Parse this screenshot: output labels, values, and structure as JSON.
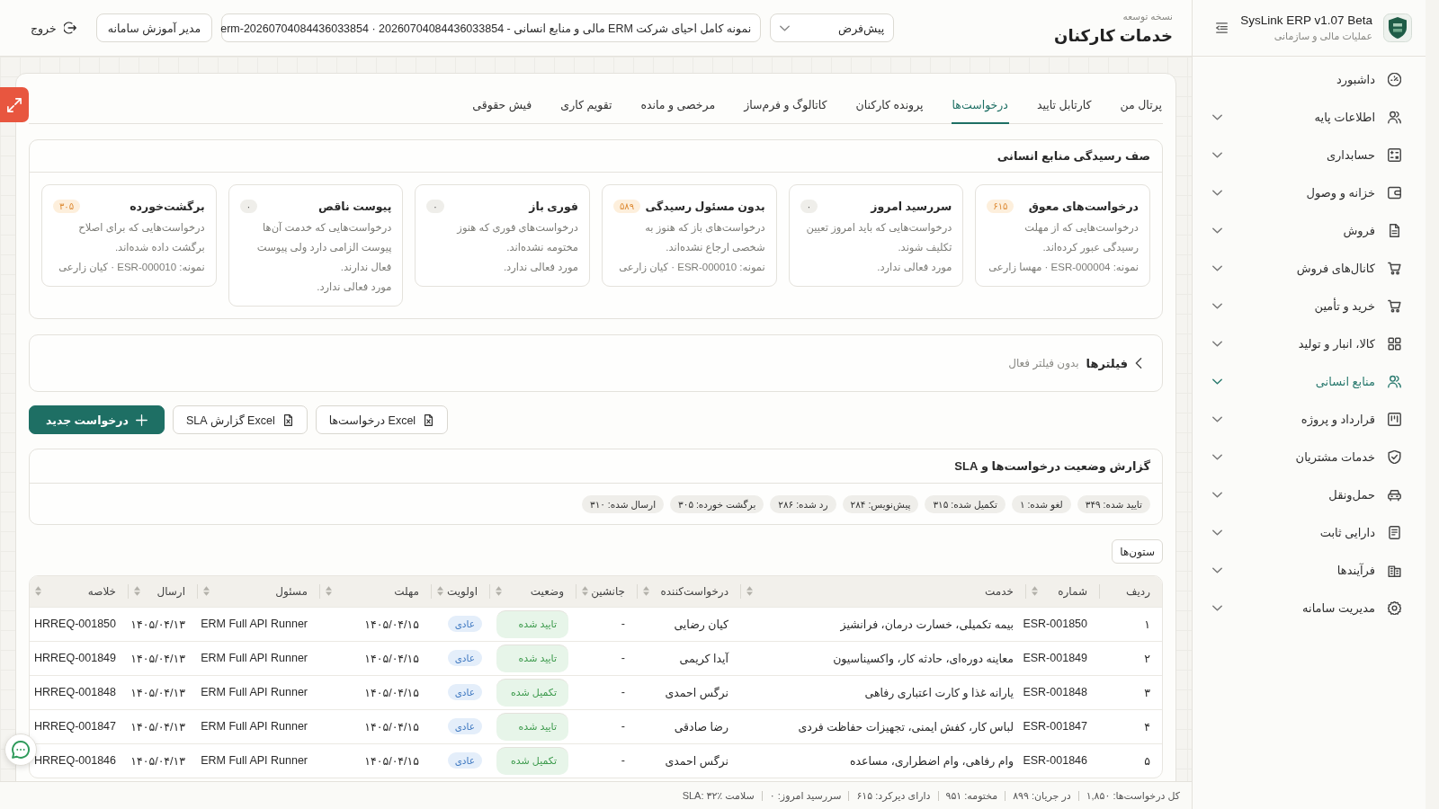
{
  "sidebar": {
    "brand": {
      "title": "SysLink ERP v1.07 Beta",
      "subtitle": "عملیات مالی و سازمانی"
    },
    "items": [
      {
        "label": "داشبورد",
        "expandable": false,
        "selected": false
      },
      {
        "label": "اطلاعات پایه",
        "expandable": true,
        "selected": false
      },
      {
        "label": "حسابداری",
        "expandable": true,
        "selected": false
      },
      {
        "label": "خزانه و وصول",
        "expandable": true,
        "selected": false
      },
      {
        "label": "فروش",
        "expandable": true,
        "selected": false
      },
      {
        "label": "کانال‌های فروش",
        "expandable": true,
        "selected": false
      },
      {
        "label": "خرید و تأمین",
        "expandable": true,
        "selected": false
      },
      {
        "label": "کالا، انبار و تولید",
        "expandable": true,
        "selected": false
      },
      {
        "label": "منابع انسانی",
        "expandable": true,
        "selected": true
      },
      {
        "label": "قرارداد و پروژه",
        "expandable": true,
        "selected": false
      },
      {
        "label": "خدمات مشتریان",
        "expandable": true,
        "selected": false
      },
      {
        "label": "حمل‌ونقل",
        "expandable": true,
        "selected": false
      },
      {
        "label": "دارایی ثابت",
        "expandable": true,
        "selected": false
      },
      {
        "label": "فرآیندها",
        "expandable": true,
        "selected": false
      },
      {
        "label": "مدیریت سامانه",
        "expandable": true,
        "selected": false
      }
    ]
  },
  "header": {
    "environment": "نسخه توسعه",
    "title": "خدمات کارکنان",
    "profile_select": {
      "value": "پیش‌فرض"
    },
    "dataset_select": {
      "value": "نمونه کامل احیای شرکت ERM مالی و منابع انسانی - 20260704084436033854 · erm-20260704084436033854"
    },
    "role_button": "مدیر آموزش سامانه",
    "logout": "خروج"
  },
  "tabs": [
    {
      "label": "پرتال من",
      "selected": false
    },
    {
      "label": "کارتابل تایید",
      "selected": false
    },
    {
      "label": "درخواست‌ها",
      "selected": true
    },
    {
      "label": "پرونده کارکنان",
      "selected": false
    },
    {
      "label": "کاتالوگ و فرم‌ساز",
      "selected": false
    },
    {
      "label": "مرخصی و مانده",
      "selected": false
    },
    {
      "label": "تقویم کاری",
      "selected": false
    },
    {
      "label": "فیش حقوقی",
      "selected": false
    }
  ],
  "queue": {
    "title": "صف رسیدگی منابع انسانی",
    "cards": [
      {
        "title": "درخواست‌های معوق",
        "count": "۶۱۵",
        "kind": "warning",
        "description": "درخواست‌هایی که از مهلت رسیدگی عبور کرده‌اند.",
        "footer": "نمونه: ESR-000004 · مهسا زارعی"
      },
      {
        "title": "سررسید امروز",
        "count": "۰",
        "kind": "neutral",
        "description": "درخواست‌هایی که باید امروز تعیین تکلیف شوند.",
        "footer": "مورد فعالی ندارد."
      },
      {
        "title": "بدون مسئول رسیدگی",
        "count": "۵۸۹",
        "kind": "warning",
        "description": "درخواست‌های باز که هنوز به شخصی ارجاع نشده‌اند.",
        "footer": "نمونه: ESR-000010 · کیان زارعی"
      },
      {
        "title": "فوری باز",
        "count": "۰",
        "kind": "neutral",
        "description": "درخواست‌های فوری که هنوز مختومه نشده‌اند.",
        "footer": "مورد فعالی ندارد."
      },
      {
        "title": "پیوست ناقص",
        "count": "۰",
        "kind": "neutral",
        "description": "درخواست‌هایی که خدمت آن‌ها پیوست الزامی دارد ولی پیوست فعال ندارند.",
        "footer": "مورد فعالی ندارد."
      },
      {
        "title": "برگشت‌خورده",
        "count": "۳۰۵",
        "kind": "warning",
        "description": "درخواست‌هایی که برای اصلاح برگشت داده شده‌اند.",
        "footer": "نمونه: ESR-000010 · کیان زارعی"
      }
    ]
  },
  "filters": {
    "title": "فیلترها",
    "summary": "بدون فیلتر فعال",
    "expanded": false
  },
  "actions": [
    {
      "label": "Excel درخواست‌ها",
      "kind": "export"
    },
    {
      "label": "Excel گزارش SLA",
      "kind": "export"
    },
    {
      "label": "درخواست جدید",
      "kind": "primary"
    }
  ],
  "sla_report": {
    "title": "گزارش وضعیت درخواست‌ها و SLA",
    "chips": [
      "تایید شده: ۳۴۹",
      "لغو شده: ۱",
      "تکمیل شده: ۳۱۵",
      "پیش‌نویس: ۲۸۴",
      "رد شده: ۲۸۶",
      "برگشت خورده: ۳۰۵",
      "ارسال شده: ۳۱۰"
    ]
  },
  "columns_button": "ستون‌ها",
  "table": {
    "columns": [
      {
        "label": "ردیف",
        "kind": "text",
        "sortable": false
      },
      {
        "label": "شماره",
        "kind": "text",
        "sortable": true
      },
      {
        "label": "خدمت",
        "kind": "text",
        "sortable": true
      },
      {
        "label": "درخواست‌کننده",
        "kind": "text",
        "sortable": true
      },
      {
        "label": "جانشین",
        "kind": "text",
        "sortable": true
      },
      {
        "label": "وضعیت",
        "kind": "status",
        "sortable": true
      },
      {
        "label": "اولویت",
        "kind": "priority",
        "sortable": true
      },
      {
        "label": "مهلت",
        "kind": "text",
        "sortable": true
      },
      {
        "label": "مسئول",
        "kind": "text",
        "sortable": true
      },
      {
        "label": "ارسال",
        "kind": "text",
        "sortable": true
      },
      {
        "label": "خلاصه",
        "kind": "text",
        "sortable": true
      }
    ],
    "rows": [
      {
        "cells": [
          "۱",
          "ESR-001850",
          "بیمه تکمیلی، خسارت درمان، فرانشیز",
          "کیان رضایی",
          "-",
          "تایید شده",
          "عادی",
          "۱۴۰۵/۰۴/۱۵",
          "ERM Full API Runner",
          "۱۴۰۵/۰۴/۱۳",
          "HRREQ-001850"
        ]
      },
      {
        "cells": [
          "۲",
          "ESR-001849",
          "معاینه دوره‌ای، حادثه کار، واکسیناسیون",
          "آیدا کریمی",
          "-",
          "تایید شده",
          "عادی",
          "۱۴۰۵/۰۴/۱۵",
          "ERM Full API Runner",
          "۱۴۰۵/۰۴/۱۳",
          "HRREQ-001849"
        ]
      },
      {
        "cells": [
          "۳",
          "ESR-001848",
          "یارانه غذا و کارت اعتباری رفاهی",
          "نرگس احمدی",
          "-",
          "تکمیل شده",
          "عادی",
          "۱۴۰۵/۰۴/۱۵",
          "ERM Full API Runner",
          "۱۴۰۵/۰۴/۱۳",
          "HRREQ-001848"
        ]
      },
      {
        "cells": [
          "۴",
          "ESR-001847",
          "لباس کار، کفش ایمنی، تجهیزات حفاظت فردی",
          "رضا صادقی",
          "-",
          "تایید شده",
          "عادی",
          "۱۴۰۵/۰۴/۱۵",
          "ERM Full API Runner",
          "۱۴۰۵/۰۴/۱۳",
          "HRREQ-001847"
        ]
      },
      {
        "cells": [
          "۵",
          "ESR-001846",
          "وام رفاهی، وام اضطراری، مساعده",
          "نرگس احمدی",
          "-",
          "تکمیل شده",
          "عادی",
          "۱۴۰۵/۰۴/۱۵",
          "ERM Full API Runner",
          "۱۴۰۵/۰۴/۱۳",
          "HRREQ-001846"
        ]
      }
    ]
  },
  "status_bar": [
    "کل درخواست‌ها: ۱,۸۵۰",
    "در جریان: ۸۹۹",
    "مختومه: ۹۵۱",
    "دارای دیرکرد: ۶۱۵",
    "سررسید امروز: ۰",
    "سلامت SLA: ۳۲٪"
  ]
}
